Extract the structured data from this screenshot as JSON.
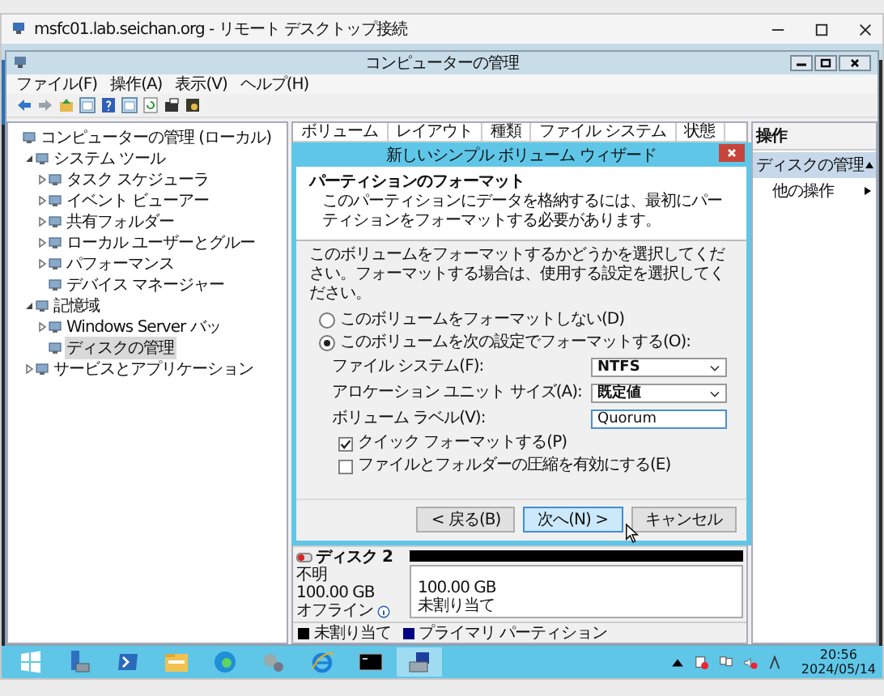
{
  "rdp_window": {
    "title": "msfc01.lab.seichan.org - リモート デスクトップ接続"
  },
  "mmc": {
    "title": "コンピューターの管理",
    "menu": [
      "ファイル(F)",
      "操作(A)",
      "表示(V)",
      "ヘルプ(H)"
    ],
    "tree": [
      {
        "label": "コンピューターの管理 (ローカル)",
        "selected": false,
        "children": [
          {
            "label": "システム ツール",
            "expanded": true,
            "selected": false,
            "children": [
              {
                "label": "タスク スケジューラ",
                "expanded": false,
                "selected": false
              },
              {
                "label": "イベント ビューアー",
                "expanded": false,
                "selected": false
              },
              {
                "label": "共有フォルダー",
                "expanded": false,
                "selected": false
              },
              {
                "label": "ローカル ユーザーとグルー",
                "expanded": false,
                "selected": false
              },
              {
                "label": "パフォーマンス",
                "expanded": false,
                "selected": false
              },
              {
                "label": "デバイス マネージャー",
                "selected": false
              }
            ]
          },
          {
            "label": "記憶域",
            "expanded": true,
            "selected": false,
            "children": [
              {
                "label": "Windows Server バッ",
                "expanded": false,
                "selected": false
              },
              {
                "label": "ディスクの管理",
                "selected": true
              }
            ]
          },
          {
            "label": "サービスとアプリケーション",
            "expanded": false,
            "selected": false
          }
        ]
      }
    ],
    "columns": [
      "ボリューム",
      "レイアウト",
      "種類",
      "ファイル システム",
      "状態"
    ],
    "disk": {
      "name": "ディスク 2",
      "type": "不明",
      "size": "100.00 GB",
      "status": "オフライン",
      "partition_size": "100.00 GB",
      "partition_state": "未割り当て"
    },
    "legend": [
      {
        "label": "未割り当て",
        "color": "#000000"
      },
      {
        "label": "プライマリ パーティション",
        "color": "#000080"
      }
    ],
    "actions": {
      "header": "操作",
      "section": "ディスクの管理",
      "items": [
        "他の操作"
      ]
    }
  },
  "wizard": {
    "title": "新しいシンプル ボリューム ウィザード",
    "heading": "パーティションのフォーマット",
    "subheading": "このパーティションにデータを格納するには、最初にパーティションをフォーマットする必要があります。",
    "instructions": "このボリュームをフォーマットするかどうかを選択してください。フォーマットする場合は、使用する設定を選択してください。",
    "options": [
      {
        "label": "このボリュームをフォーマットしない(D)",
        "selected": false
      },
      {
        "label": "このボリュームを次の設定でフォーマットする(O):",
        "selected": true
      }
    ],
    "fields": [
      {
        "kind": "select",
        "label": "ファイル システム(F):",
        "value": "NTFS"
      },
      {
        "kind": "select",
        "label": "アロケーション ユニット サイズ(A):",
        "value": "既定値"
      },
      {
        "kind": "text",
        "label": "ボリューム ラベル(V):",
        "value": "Quorum"
      }
    ],
    "checkboxes": [
      {
        "label": "クイック フォーマットする(P)",
        "checked": true
      },
      {
        "label": "ファイルとフォルダーの圧縮を有効にする(E)",
        "checked": false
      }
    ],
    "buttons": [
      {
        "label": "< 戻る(B)",
        "default": false
      },
      {
        "label": "次へ(N) >",
        "default": true
      },
      {
        "label": "キャンセル",
        "default": false
      }
    ]
  },
  "taskbar": {
    "time": "20:56",
    "date": "2024/05/14"
  }
}
